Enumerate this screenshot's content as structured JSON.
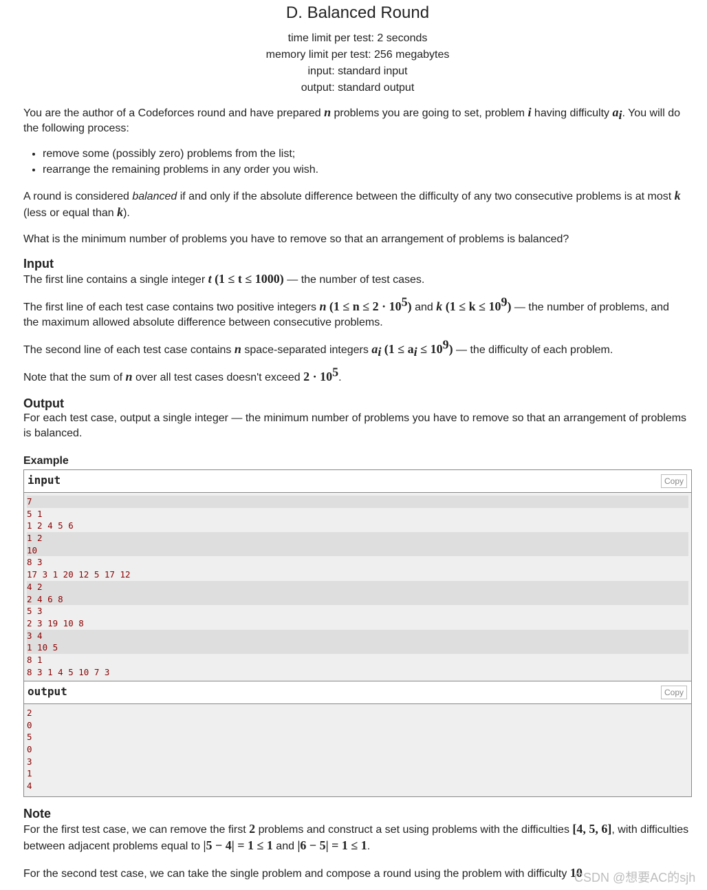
{
  "problem": {
    "title": "D. Balanced Round",
    "limits": [
      "time limit per test: 2 seconds",
      "memory limit per test: 256 megabytes",
      "input: standard input",
      "output: standard output"
    ]
  },
  "statement": {
    "p1_a": "You are the author of a Codeforces round and have prepared ",
    "p1_n": "n",
    "p1_b": " problems you are going to set, problem ",
    "p1_i": "i",
    "p1_c": " having difficulty ",
    "p1_a_var": "a",
    "p1_a_sub": "i",
    "p1_d": ". You will do the following process:",
    "bullets": [
      "remove some (possibly zero) problems from the list;",
      "rearrange the remaining problems in any order you wish."
    ],
    "p2_a": "A round is considered ",
    "p2_em": "balanced",
    "p2_b": " if and only if the absolute difference between the difficulty of any two consecutive problems is at most ",
    "p2_k": "k",
    "p2_c": " (less or equal than ",
    "p2_k2": "k",
    "p2_d": ").",
    "p3": "What is the minimum number of problems you have to remove so that an arrangement of problems is balanced?"
  },
  "input_section": {
    "title": "Input",
    "l1_a": "The first line contains a single integer ",
    "l1_t": "t",
    "l1_math": "(1 ≤ t ≤ 1000)",
    "l1_b": " — the number of test cases.",
    "l2_a": "The first line of each test case contains two positive integers ",
    "l2_n": "n",
    "l2_math1": "(1 ≤ n ≤ 2 · 10",
    "l2_exp1": "5",
    "l2_b": " and ",
    "l2_k": "k",
    "l2_math2": "(1 ≤ k ≤ 10",
    "l2_exp2": "9",
    "l2_c": " — the number of problems, and the maximum allowed absolute difference between consecutive problems.",
    "l3_a": "The second line of each test case contains ",
    "l3_n": "n",
    "l3_b": " space-separated integers ",
    "l3_a_var": "a",
    "l3_a_sub": "i",
    "l3_math": "(1 ≤ a",
    "l3_math_sub": "i",
    "l3_math2": " ≤ 10",
    "l3_exp": "9",
    "l3_c": " — the difficulty of each problem.",
    "l4_a": "Note that the sum of ",
    "l4_n": "n",
    "l4_b": " over all test cases doesn't exceed ",
    "l4_math": "2 · 10",
    "l4_exp": "5",
    "l4_c": "."
  },
  "output_section": {
    "title": "Output",
    "text": "For each test case, output a single integer — the minimum number of problems you have to remove so that an arrangement of problems is balanced."
  },
  "example": {
    "title": "Example",
    "input_label": "input",
    "output_label": "output",
    "copy_label": "Copy",
    "input_lines": [
      {
        "text": "7",
        "group": 0
      },
      {
        "text": "5 1",
        "group": 1
      },
      {
        "text": "1 2 4 5 6",
        "group": 1
      },
      {
        "text": "1 2",
        "group": 2
      },
      {
        "text": "10",
        "group": 2
      },
      {
        "text": "8 3",
        "group": 3
      },
      {
        "text": "17 3 1 20 12 5 17 12",
        "group": 3
      },
      {
        "text": "4 2",
        "group": 4
      },
      {
        "text": "2 4 6 8",
        "group": 4
      },
      {
        "text": "5 3",
        "group": 5
      },
      {
        "text": "2 3 19 10 8",
        "group": 5
      },
      {
        "text": "3 4",
        "group": 6
      },
      {
        "text": "1 10 5",
        "group": 6
      },
      {
        "text": "8 1",
        "group": 7
      },
      {
        "text": "8 3 1 4 5 10 7 3",
        "group": 7
      }
    ],
    "output_lines": [
      "2",
      "0",
      "5",
      "0",
      "3",
      "1",
      "4"
    ]
  },
  "note": {
    "title": "Note",
    "n1_a": "For the first test case, we can remove the first ",
    "n1_two": "2",
    "n1_b": " problems and construct a set using problems with the difficulties ",
    "n1_set": "[4, 5, 6]",
    "n1_c": ", with difficulties between adjacent problems equal to ",
    "n1_m1": "|5 − 4| = 1 ≤ 1",
    "n1_d": " and ",
    "n1_m2": "|6 − 5| = 1 ≤ 1",
    "n1_e": ".",
    "n2_a": "For the second test case, we can take the single problem and compose a round using the problem with difficulty ",
    "n2_ten": "10"
  },
  "watermark": "CSDN @想要AC的sjh"
}
